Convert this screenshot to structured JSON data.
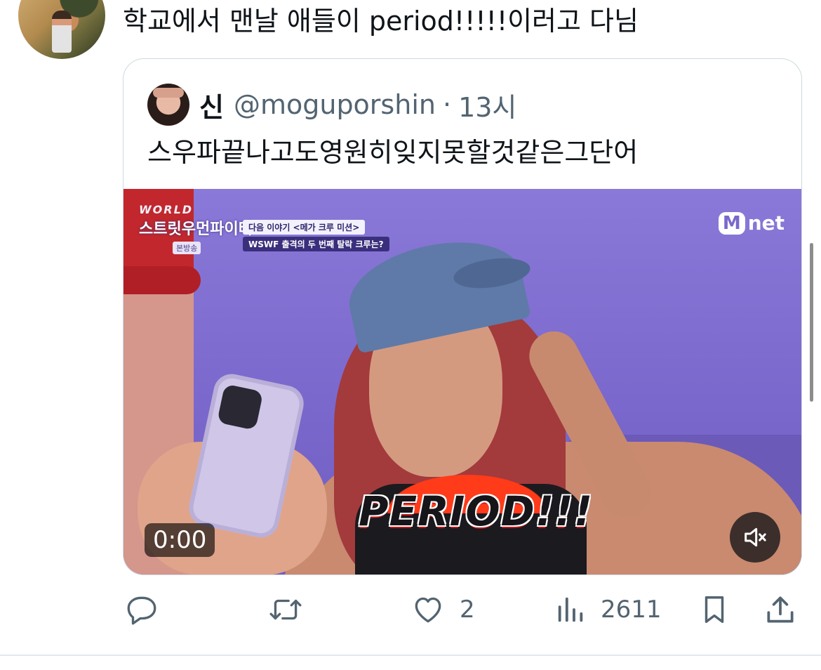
{
  "tweet": {
    "text": "학교에서 맨날 애들이 period!!!!!이러고 다님",
    "avatar_icon": "user-avatar-photo"
  },
  "quote": {
    "name": "신",
    "handle": "@moguporshin",
    "separator": "·",
    "time": "13시",
    "text": "스우파끝나고도영원히잊지못할것같은그단어",
    "avatar_icon": "user-avatar-photo"
  },
  "video": {
    "show_logo_top": "WORLD",
    "show_logo_main": "스트릿우먼파이터",
    "show_logo_sub": "본방송",
    "info_line1": "다음 이야기 <메가 크루 미션>",
    "info_line2": "WSWF 출격의 두 번째 탈락 크루는?",
    "channel_m": "M",
    "channel_rest": "net",
    "caption": "PERIOD!!!",
    "timer": "0:00",
    "mute_icon": "volume-muted-icon"
  },
  "actions": {
    "reply_icon": "reply-icon",
    "retweet_icon": "retweet-icon",
    "like_icon": "heart-icon",
    "like_count": "2",
    "views_icon": "views-chart-icon",
    "views_count": "2611",
    "bookmark_icon": "bookmark-icon",
    "share_icon": "share-icon"
  },
  "colors": {
    "text_primary": "#0f1419",
    "text_secondary": "#536471",
    "border": "#cfd9de",
    "video_bg": "#7b68cc"
  }
}
